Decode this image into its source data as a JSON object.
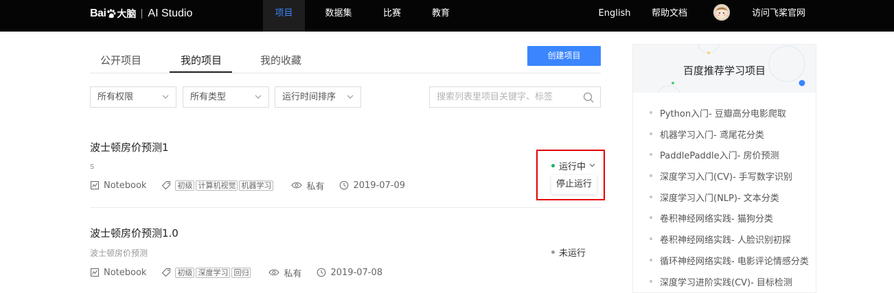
{
  "topnav": {
    "logo_bai": "Bai",
    "logo_cn": "大脑",
    "logo_ai": "AI Studio",
    "items": [
      {
        "label": "项目",
        "active": true
      },
      {
        "label": "数据集",
        "active": false
      },
      {
        "label": "比赛",
        "active": false
      },
      {
        "label": "教育",
        "active": false
      }
    ],
    "english": "English",
    "help_docs": "帮助文档",
    "visit_site": "访问飞桨官网"
  },
  "tabs": [
    "公开项目",
    "我的项目",
    "我的收藏"
  ],
  "active_tab": "我的项目",
  "create_button": "创建项目",
  "filters": {
    "permission": "所有权限",
    "type": "所有类型",
    "sort": "运行时间排序"
  },
  "search": {
    "placeholder": "搜索列表里项目关键字、标签"
  },
  "projects": [
    {
      "title": "波士顿房价预测1",
      "description": "s",
      "env": "Notebook",
      "tags": [
        "初级",
        "计算机视觉",
        "机器学习"
      ],
      "visibility": "私有",
      "date": "2019-07-09",
      "status": "运行中",
      "status_color": "#17b26a",
      "action": "停止运行"
    },
    {
      "title": "波士顿房价预测1.0",
      "description": "波士顿房价预测",
      "env": "Notebook",
      "tags": [
        "初级",
        "深度学习",
        "回归"
      ],
      "visibility": "私有",
      "date": "2019-07-08",
      "status": "未运行",
      "status_color": "#999999"
    }
  ],
  "sidebar": {
    "title": "百度推荐学习项目",
    "items": [
      "Python入门- 豆瓣高分电影爬取",
      "机器学习入门- 鸢尾花分类",
      "PaddlePaddle入门- 房价预测",
      "深度学习入门(CV)- 手写数字识别",
      "深度学习入门(NLP)- 文本分类",
      "卷积神经网络实践- 猫狗分类",
      "卷积神经网络实践- 人脸识别初探",
      "循环神经网络实践- 电影评论情感分类",
      "深度学习进阶实践(CV)- 目标检测"
    ]
  },
  "colors": {
    "accent": "#3b86ff",
    "highlight": "#e60000",
    "nav_bg": "#050505"
  }
}
